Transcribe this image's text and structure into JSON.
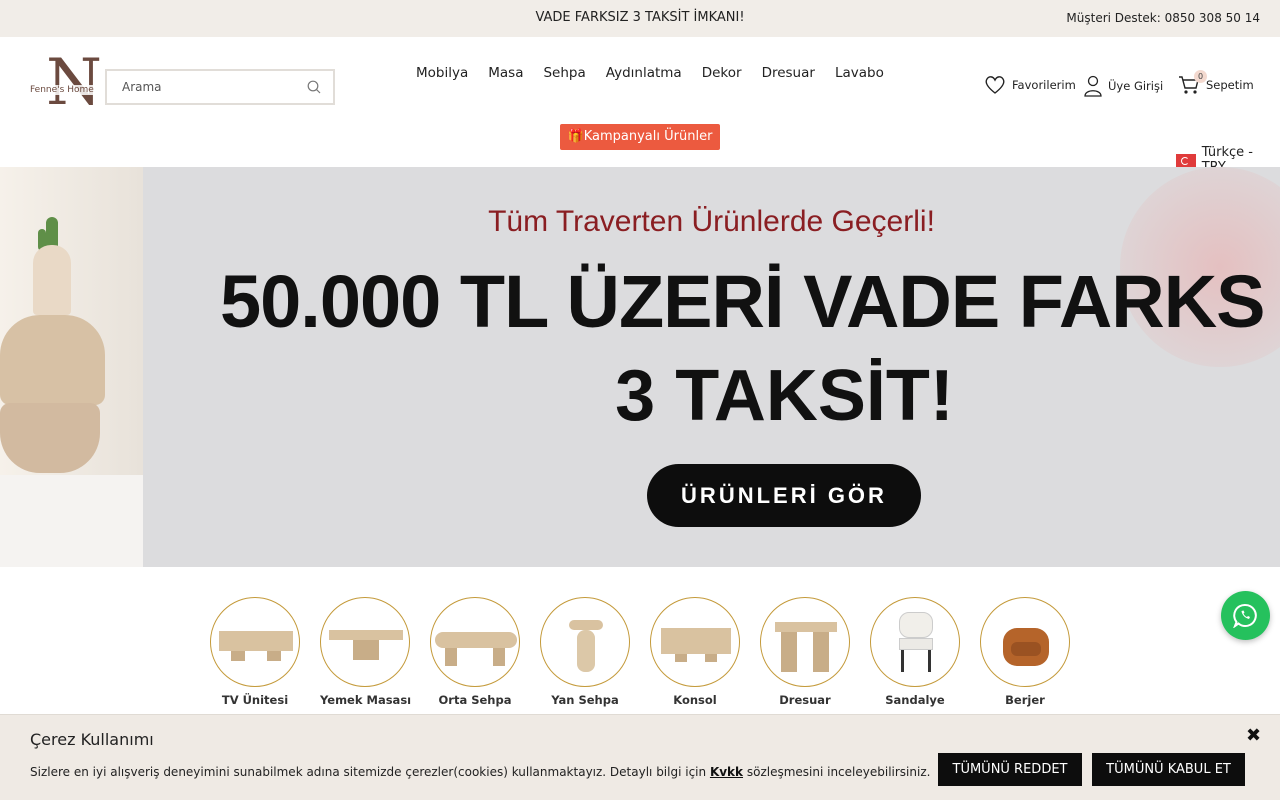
{
  "topbar": {
    "promo": "VADE FARKSIZ 3 TAKSİT İMKANI!",
    "support": "Müşteri Destek: 0850 308 50 14"
  },
  "header": {
    "logo_letter": "N",
    "logo_name": "Fenne's Home",
    "search_placeholder": "Arama",
    "nav": [
      "Mobilya",
      "Masa",
      "Sehpa",
      "Aydınlatma",
      "Dekor",
      "Dresuar",
      "Lavabo"
    ],
    "campaign": "🎁Kampanyalı Ürünler",
    "favorites": "Favorilerim",
    "login": "Üye Girişi",
    "cart": "Sepetim",
    "cart_count": "0",
    "language": "Türkçe - TRY"
  },
  "hero": {
    "subtitle": "Tüm Traverten Ürünlerde Geçerli!",
    "title_line1": "50.000 TL ÜZERİ VADE FARKS",
    "title_line2": "3 TAKSİT!",
    "button": "ÜRÜNLERİ GÖR"
  },
  "categories": [
    {
      "label": "TV Ünitesi"
    },
    {
      "label": "Yemek Masası"
    },
    {
      "label": "Orta Sehpa"
    },
    {
      "label": "Yan Sehpa"
    },
    {
      "label": "Konsol"
    },
    {
      "label": "Dresuar"
    },
    {
      "label": "Sandalye"
    },
    {
      "label": "Berjer"
    }
  ],
  "cookie": {
    "title": "Çerez Kullanımı",
    "text_before": "Sizlere en iyi alışveriş deneyimini sunabilmek adına sitemizde çerezler(cookies) kullanmaktayız. Detaylı bilgi için ",
    "link": "Kvkk",
    "text_after": " sözleşmesini inceleyebilirsiniz.",
    "reject": "TÜMÜNÜ REDDET",
    "accept": "TÜMÜNÜ KABUL ET",
    "close": "✖"
  },
  "colors": {
    "accent": "#ec5a3f",
    "whatsapp": "#25c15d",
    "category_border": "#c49a3a"
  },
  "icons": [
    "search-icon",
    "heart-icon",
    "user-icon",
    "cart-icon",
    "turkey-flag-icon",
    "whatsapp-icon",
    "close-icon"
  ]
}
